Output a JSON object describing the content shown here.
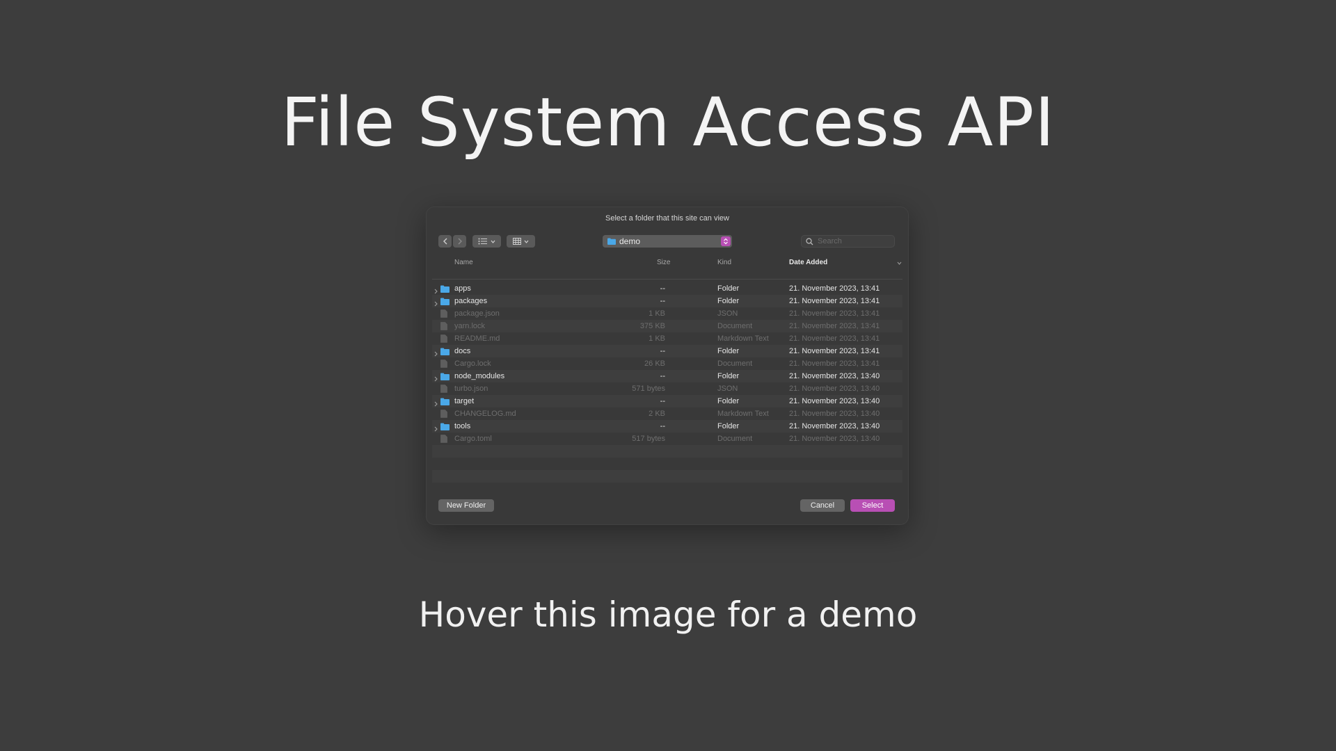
{
  "page": {
    "title": "File System Access API",
    "subtitle": "Hover this image for a demo"
  },
  "dialog": {
    "prompt": "Select a folder that this site can view",
    "location": "demo",
    "search_placeholder": "Search",
    "columns": {
      "name": "Name",
      "size": "Size",
      "kind": "Kind",
      "date_added": "Date Added"
    },
    "files": [
      {
        "name": "apps",
        "size": "--",
        "kind": "Folder",
        "date": "21. November 2023, 13:41",
        "is_folder": true
      },
      {
        "name": "packages",
        "size": "--",
        "kind": "Folder",
        "date": "21. November 2023, 13:41",
        "is_folder": true
      },
      {
        "name": "package.json",
        "size": "1 KB",
        "kind": "JSON",
        "date": "21. November 2023, 13:41",
        "is_folder": false
      },
      {
        "name": "yarn.lock",
        "size": "375 KB",
        "kind": "Document",
        "date": "21. November 2023, 13:41",
        "is_folder": false
      },
      {
        "name": "README.md",
        "size": "1 KB",
        "kind": "Markdown Text",
        "date": "21. November 2023, 13:41",
        "is_folder": false
      },
      {
        "name": "docs",
        "size": "--",
        "kind": "Folder",
        "date": "21. November 2023, 13:41",
        "is_folder": true
      },
      {
        "name": "Cargo.lock",
        "size": "26 KB",
        "kind": "Document",
        "date": "21. November 2023, 13:41",
        "is_folder": false
      },
      {
        "name": "node_modules",
        "size": "--",
        "kind": "Folder",
        "date": "21. November 2023, 13:40",
        "is_folder": true
      },
      {
        "name": "turbo.json",
        "size": "571 bytes",
        "kind": "JSON",
        "date": "21. November 2023, 13:40",
        "is_folder": false
      },
      {
        "name": "target",
        "size": "--",
        "kind": "Folder",
        "date": "21. November 2023, 13:40",
        "is_folder": true
      },
      {
        "name": "CHANGELOG.md",
        "size": "2 KB",
        "kind": "Markdown Text",
        "date": "21. November 2023, 13:40",
        "is_folder": false
      },
      {
        "name": "tools",
        "size": "--",
        "kind": "Folder",
        "date": "21. November 2023, 13:40",
        "is_folder": true
      },
      {
        "name": "Cargo.toml",
        "size": "517 bytes",
        "kind": "Document",
        "date": "21. November 2023, 13:40",
        "is_folder": false
      }
    ],
    "buttons": {
      "new_folder": "New Folder",
      "cancel": "Cancel",
      "select": "Select"
    }
  },
  "colors": {
    "background": "#3d3d3d",
    "dialog": "#393939",
    "accent": "#b84fb4",
    "folder": "#4aa8e8"
  }
}
